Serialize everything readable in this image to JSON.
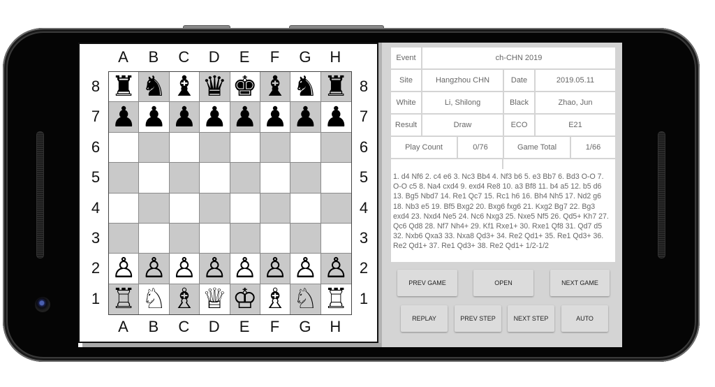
{
  "board": {
    "files": [
      "A",
      "B",
      "C",
      "D",
      "E",
      "F",
      "G",
      "H"
    ],
    "ranks": [
      "8",
      "7",
      "6",
      "5",
      "4",
      "3",
      "2",
      "1"
    ],
    "position": [
      [
        "br",
        "bn",
        "bb",
        "bq",
        "bk",
        "bb",
        "bn",
        "br"
      ],
      [
        "bp",
        "bp",
        "bp",
        "bp",
        "bp",
        "bp",
        "bp",
        "bp"
      ],
      [
        "",
        "",
        "",
        "",
        "",
        "",
        "",
        ""
      ],
      [
        "",
        "",
        "",
        "",
        "",
        "",
        "",
        ""
      ],
      [
        "",
        "",
        "",
        "",
        "",
        "",
        "",
        ""
      ],
      [
        "",
        "",
        "",
        "",
        "",
        "",
        "",
        ""
      ],
      [
        "wp",
        "wp",
        "wp",
        "wp",
        "wp",
        "wp",
        "wp",
        "wp"
      ],
      [
        "wr",
        "wn",
        "wb",
        "wq",
        "wk",
        "wb",
        "wn",
        "wr"
      ]
    ],
    "piece_glyphs": {
      "br": "♜",
      "bn": "♞",
      "bb": "♝",
      "bq": "♛",
      "bk": "♚",
      "bp": "♟",
      "wr": "♖",
      "wn": "♘",
      "wb": "♗",
      "wq": "♕",
      "wk": "♔",
      "wp": "♙"
    },
    "colors": {
      "light": "#ffffff",
      "dark": "#c9c9c9"
    }
  },
  "game_info": {
    "event_label": "Event",
    "event_value": "ch-CHN 2019",
    "site_label": "Site",
    "site_value": "Hangzhou CHN",
    "date_label": "Date",
    "date_value": "2019.05.11",
    "white_label": "White",
    "white_value": "Li, Shilong",
    "black_label": "Black",
    "black_value": "Zhao, Jun",
    "result_label": "Result",
    "result_value": "Draw",
    "eco_label": "ECO",
    "eco_value": "E21",
    "play_count_label": "Play Count",
    "play_count_value": "0/76",
    "game_total_label": "Game Total",
    "game_total_value": "1/66",
    "extra_left": "",
    "extra_right": ""
  },
  "moves_text": " 1. d4 Nf6 2. c4 e6 3. Nc3 Bb4 4. Nf3 b6 5. e3 Bb7 6. Bd3 O-O 7. O-O c5 8. Na4 cxd4 9. exd4 Re8 10. a3 Bf8 11. b4 a5 12. b5 d6 13. Bg5 Nbd7 14. Re1 Qc7 15. Rc1 h6 16. Bh4 Nh5 17. Nd2 g6 18. Nb3 e5 19. Bf5 Bxg2 20. Bxg6 fxg6 21. Kxg2 Bg7 22. Bg3 exd4 23. Nxd4 Ne5 24. Nc6 Nxg3 25. Nxe5 Nf5 26. Qd5+ Kh7 27. Qc6 Qd8 28. Nf7 Nh4+ 29. Kf1 Rxe1+ 30. Rxe1 Qf8 31. Qd7 d5 32. Nxb6 Qxa3 33. Nxa8 Qd3+ 34. Re2 Qd1+ 35. Re1 Qd3+ 36. Re2 Qd1+ 37. Re1 Qd3+ 38. Re2 Qd1+ 1/2-1/2",
  "buttons": {
    "prev_game": "PREV GAME",
    "open": "OPEN",
    "next_game": "NEXT GAME",
    "replay": "REPLAY",
    "prev_step": "PREV STEP",
    "next_step": "NEXT STEP",
    "auto": "AUTO"
  }
}
